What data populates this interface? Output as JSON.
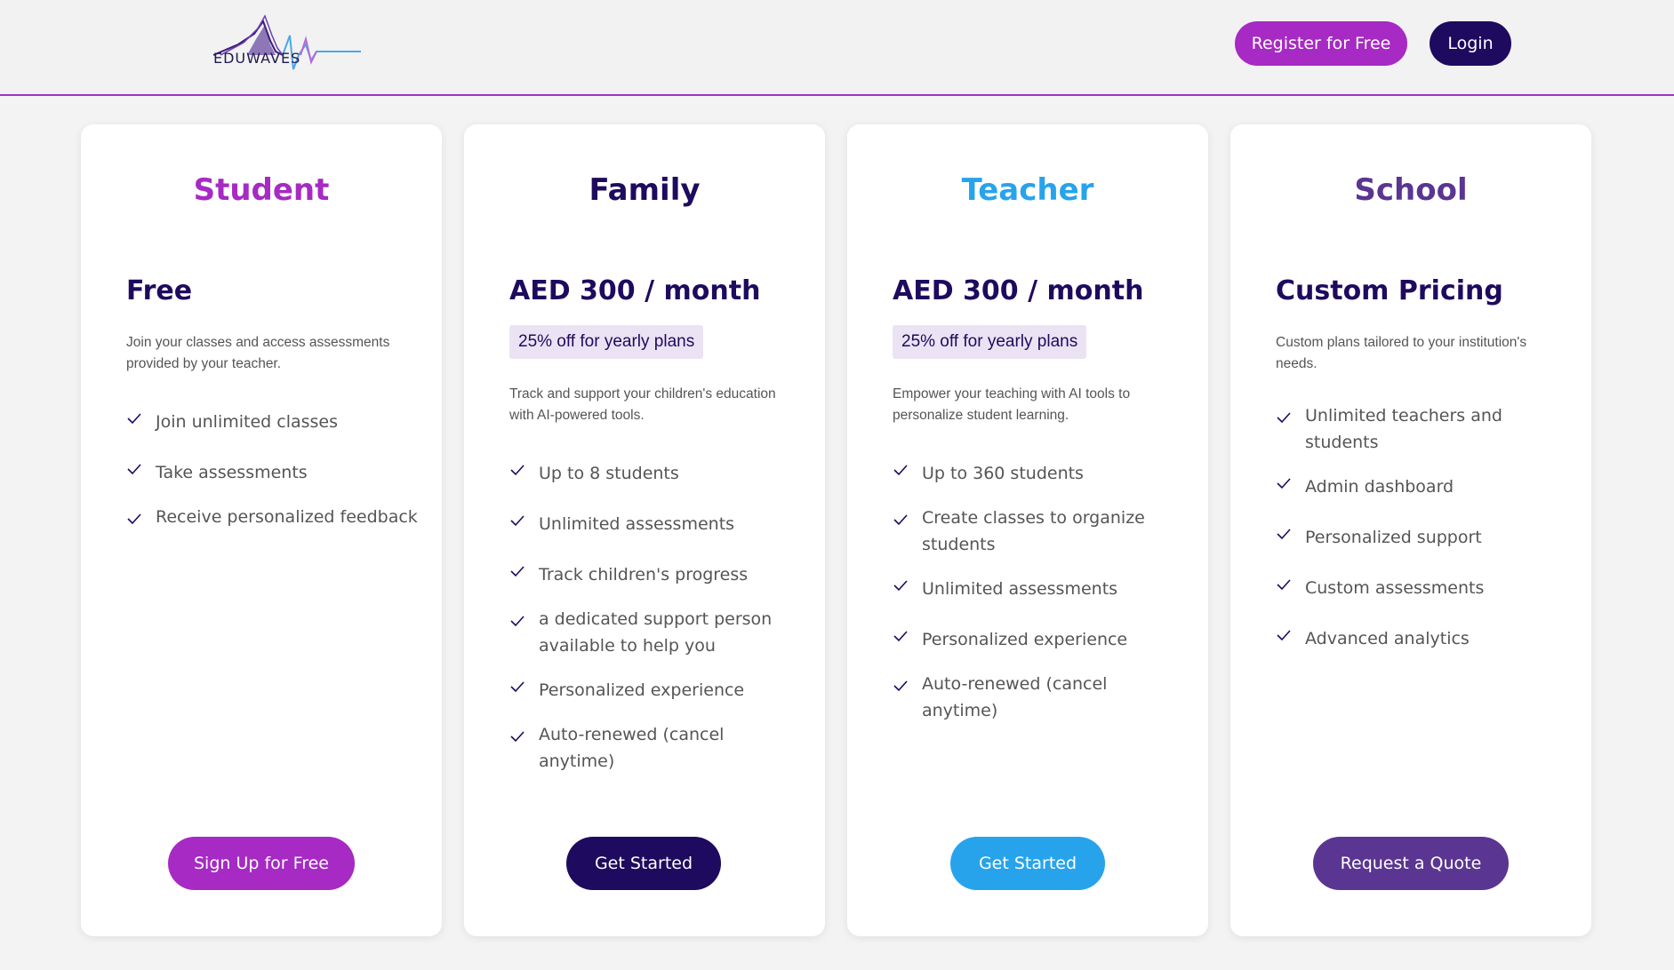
{
  "header": {
    "logo_text": "EDUWAVES",
    "register_label": "Register for Free",
    "login_label": "Login"
  },
  "plans": [
    {
      "name": "Student",
      "name_color": "#a62ac3",
      "price": "Free",
      "discount": "",
      "description": "Join your classes and access assessments provided by your teacher.",
      "features": [
        "Join unlimited classes",
        "Take assessments",
        "Receive personalized feedback"
      ],
      "button_label": "Sign Up for Free",
      "button_color": "#a62ac3"
    },
    {
      "name": "Family",
      "name_color": "#1e0a5e",
      "price": "AED 300 / month",
      "discount": "25% off for yearly plans",
      "description": "Track and support your children's education with AI-powered tools.",
      "features": [
        "Up to 8 students",
        "Unlimited assessments",
        "Track children's progress",
        "a dedicated support person available to help you",
        "Personalized experience",
        "Auto-renewed (cancel anytime)"
      ],
      "button_label": "Get Started",
      "button_color": "#1e0a5e"
    },
    {
      "name": "Teacher",
      "name_color": "#27a3ec",
      "price": "AED 300 / month",
      "discount": "25% off for yearly plans",
      "description": "Empower your teaching with AI tools to personalize student learning.",
      "features": [
        "Up to 360 students",
        "Create classes to organize students",
        "Unlimited assessments",
        "Personalized experience",
        "Auto-renewed (cancel anytime)"
      ],
      "button_label": "Get Started",
      "button_color": "#27a3ec"
    },
    {
      "name": "School",
      "name_color": "#5a3591",
      "price": "Custom Pricing",
      "discount": "",
      "description": "Custom plans tailored to your institution's needs.",
      "features": [
        "Unlimited teachers and students",
        "Admin dashboard",
        "Personalized support",
        "Custom assessments",
        "Advanced analytics"
      ],
      "button_label": "Request a Quote",
      "button_color": "#5a3591"
    }
  ],
  "icons": {
    "check": "check-icon"
  }
}
